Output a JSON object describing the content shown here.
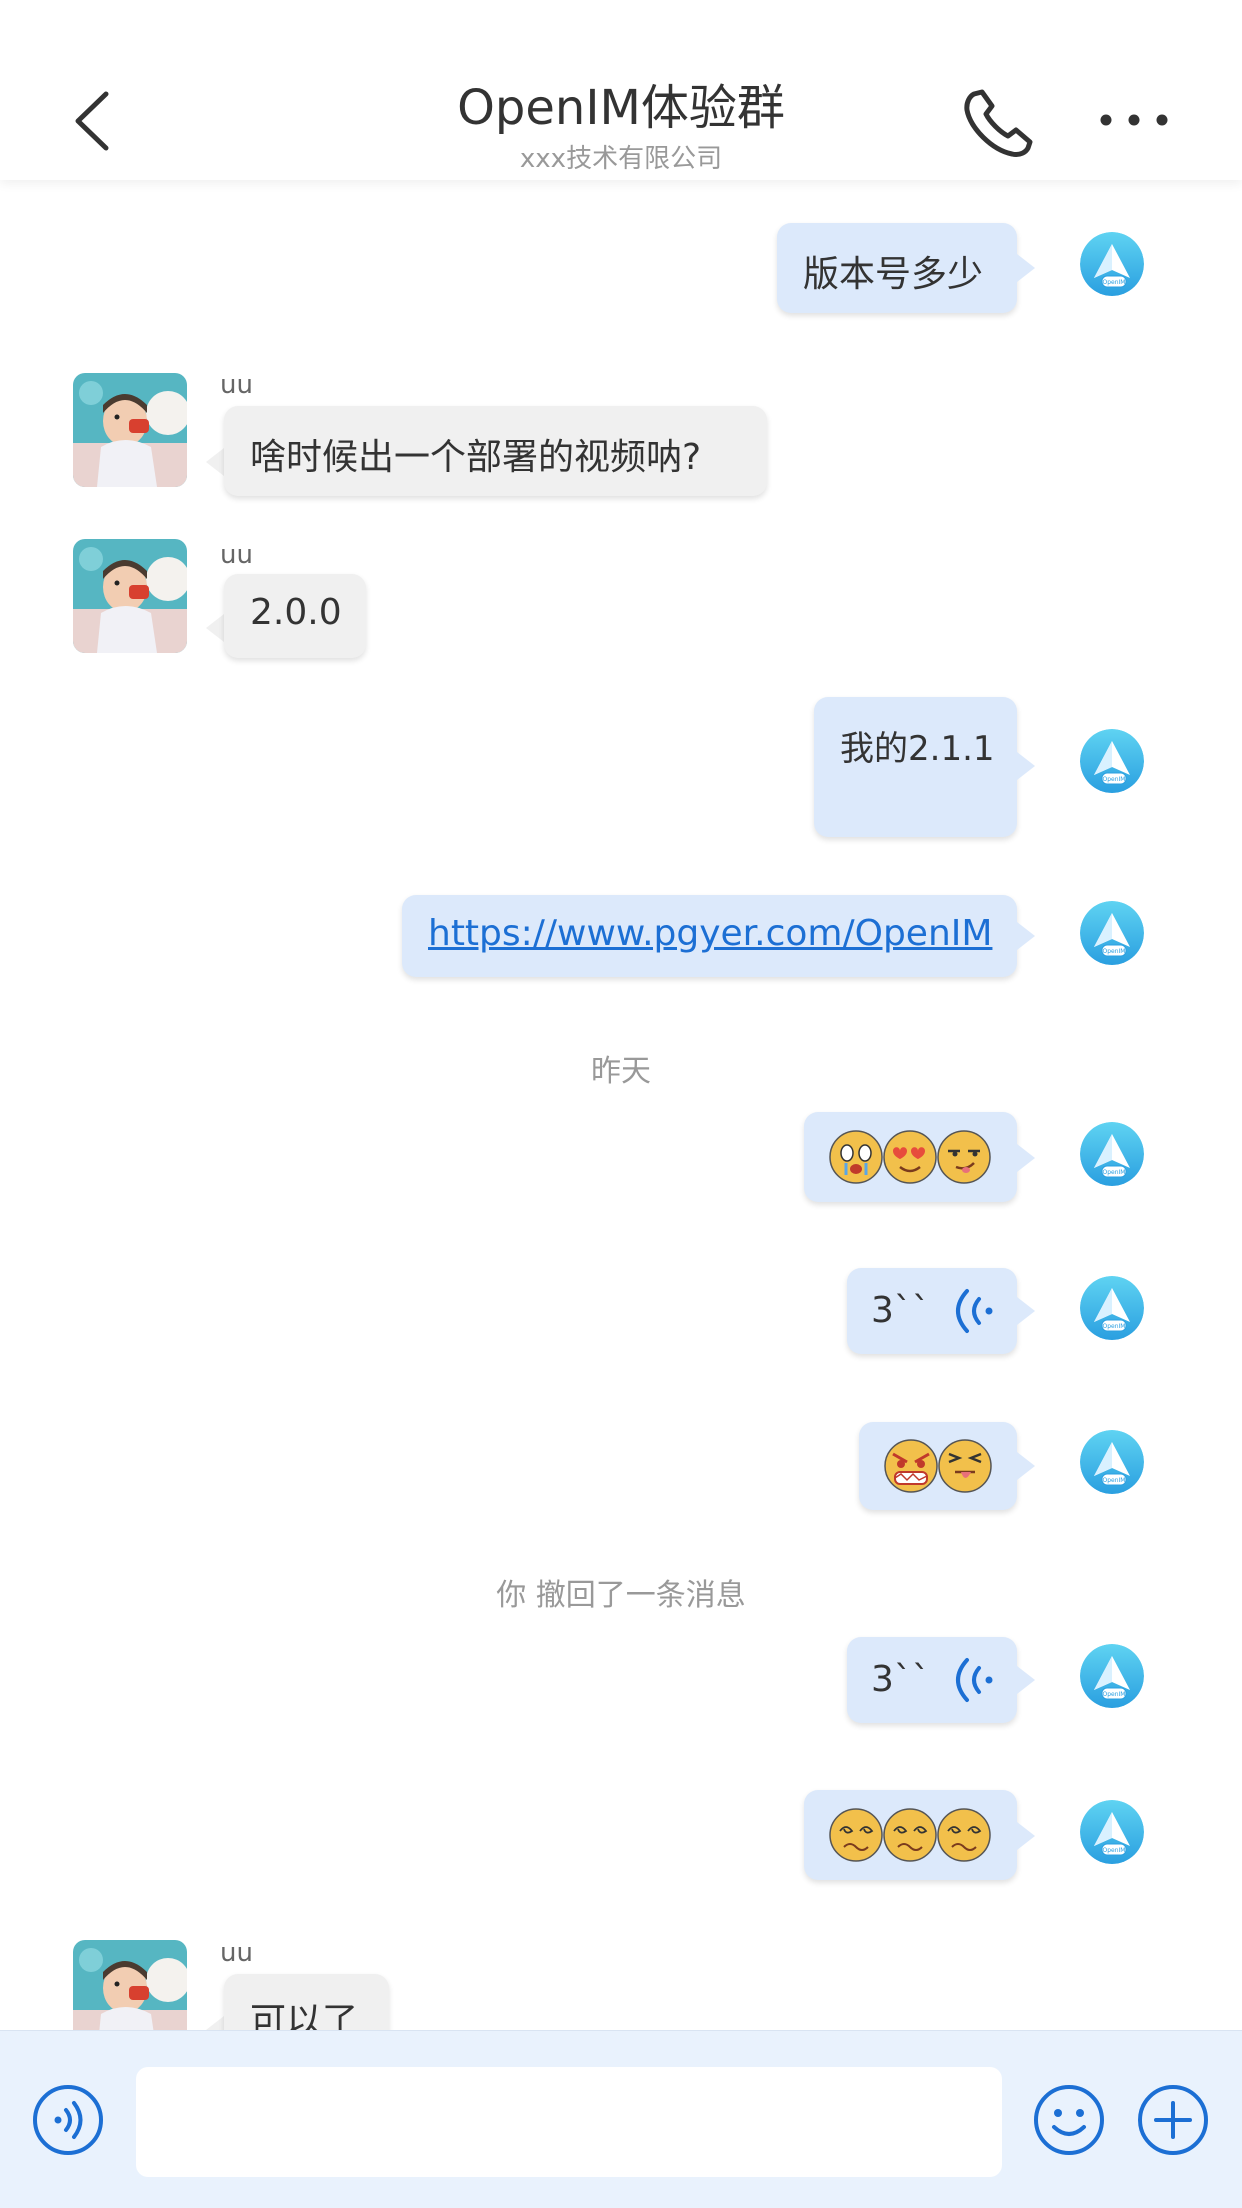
{
  "header": {
    "title": "OpenIM体验群",
    "subtitle": "xxx技术有限公司",
    "back_icon": "chevron-left-icon",
    "call_icon": "phone-icon",
    "more_icon": "more-dots-icon"
  },
  "colors": {
    "accent": "#1c6fd4",
    "bubble_me": "#dce9fb",
    "bubble_other": "#f0f0f0",
    "bar_bg": "#e9f2fd"
  },
  "messages": {
    "m1": {
      "text": "版本号多少"
    },
    "m2": {
      "nick": "uu",
      "text": "啥时候出一个部署的视频呐?"
    },
    "m3": {
      "nick": "uu",
      "text": "2.0.0"
    },
    "m4": {
      "text": "我的2.1.1"
    },
    "m5": {
      "text": "https://www.pgyer.com/OpenIM"
    },
    "time_yesterday": "昨天",
    "m6": {
      "emoji": [
        "crying-emoji",
        "heart-eyes-emoji",
        "smirk-emoji"
      ]
    },
    "m7": {
      "duration": "3``"
    },
    "m8": {
      "emoji": [
        "angry-grimace-emoji",
        "tongue-out-emoji"
      ]
    },
    "recall_notice": "你 撤回了一条消息",
    "m9": {
      "duration": "3``"
    },
    "m10": {
      "emoji": [
        "dizzy-emoji",
        "dizzy-emoji",
        "dizzy-emoji"
      ]
    },
    "m11": {
      "nick": "uu",
      "text": "可以了"
    }
  },
  "input_bar": {
    "voice_icon": "voice-mode-icon",
    "input_value": "",
    "emoji_icon": "emoji-icon",
    "plus_icon": "plus-icon"
  }
}
